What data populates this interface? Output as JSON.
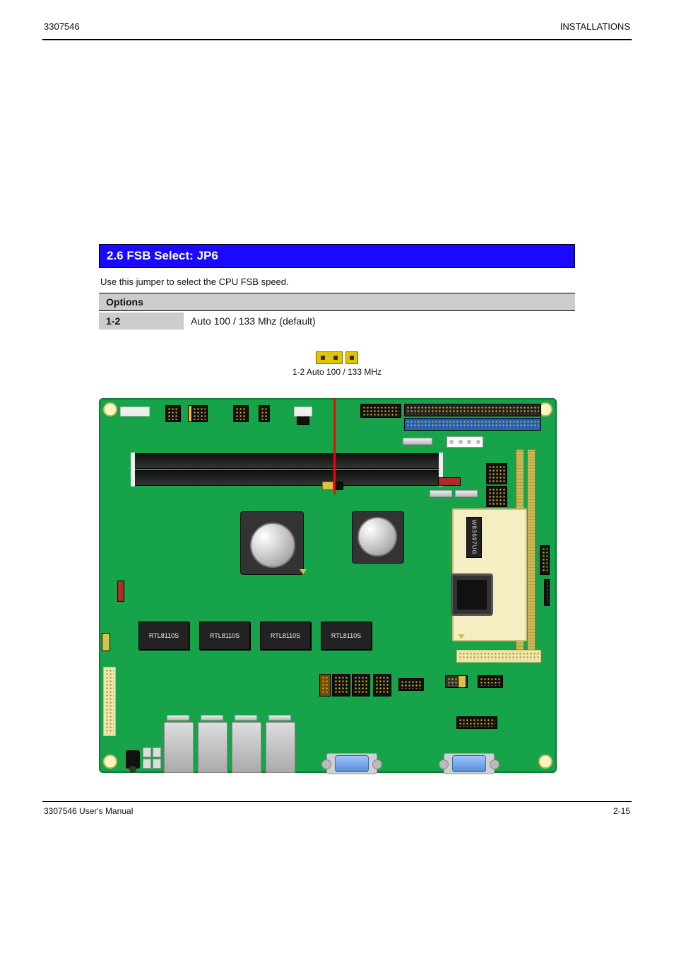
{
  "header": {
    "left": "3307546",
    "right": "INSTALLATIONS"
  },
  "section": {
    "title": "2.6   FSB Select: JP6",
    "intro": "Use this jumper to select the CPU FSB speed.",
    "options_header": "Options",
    "options": [
      {
        "label": "1-2",
        "desc": "Auto 100 / 133 Mhz (default)"
      }
    ],
    "jumper_caption": "1-2 Auto 100 / 133 MHz"
  },
  "pcb": {
    "nic_label": "RTL8110S",
    "sio_label": "W83697UG"
  },
  "footer": {
    "left": "3307546 User's Manual",
    "right": "2-15"
  }
}
